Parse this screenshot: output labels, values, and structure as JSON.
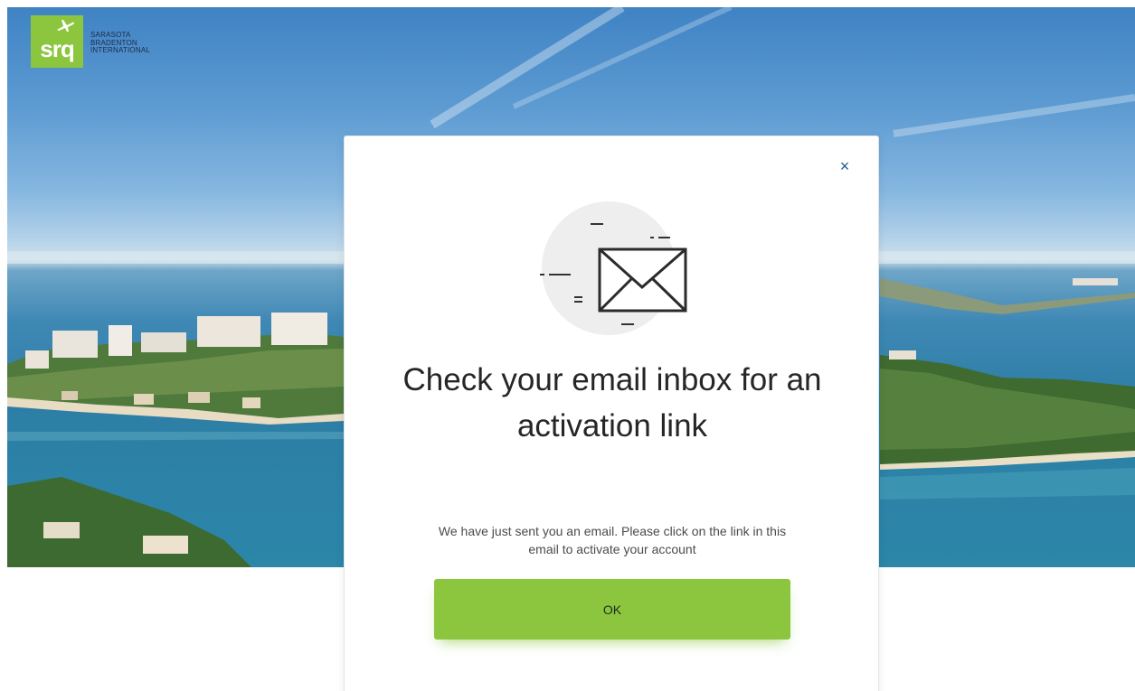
{
  "logo": {
    "mark_text": "srq",
    "line1": "SARASOTA",
    "line2": "BRADENTON",
    "line3": "INTERNATIONAL"
  },
  "modal": {
    "close_glyph": "×",
    "heading": "Check your email inbox for an activation link",
    "message": "We have just sent you an email. Please click on the link in this email to activate your account",
    "ok_label": "OK"
  },
  "colors": {
    "brand_green": "#8cc63f",
    "close_blue": "#1f5c8e",
    "heading_text": "#262626"
  },
  "icons": [
    "airplane-icon",
    "close-icon",
    "envelope-icon"
  ]
}
